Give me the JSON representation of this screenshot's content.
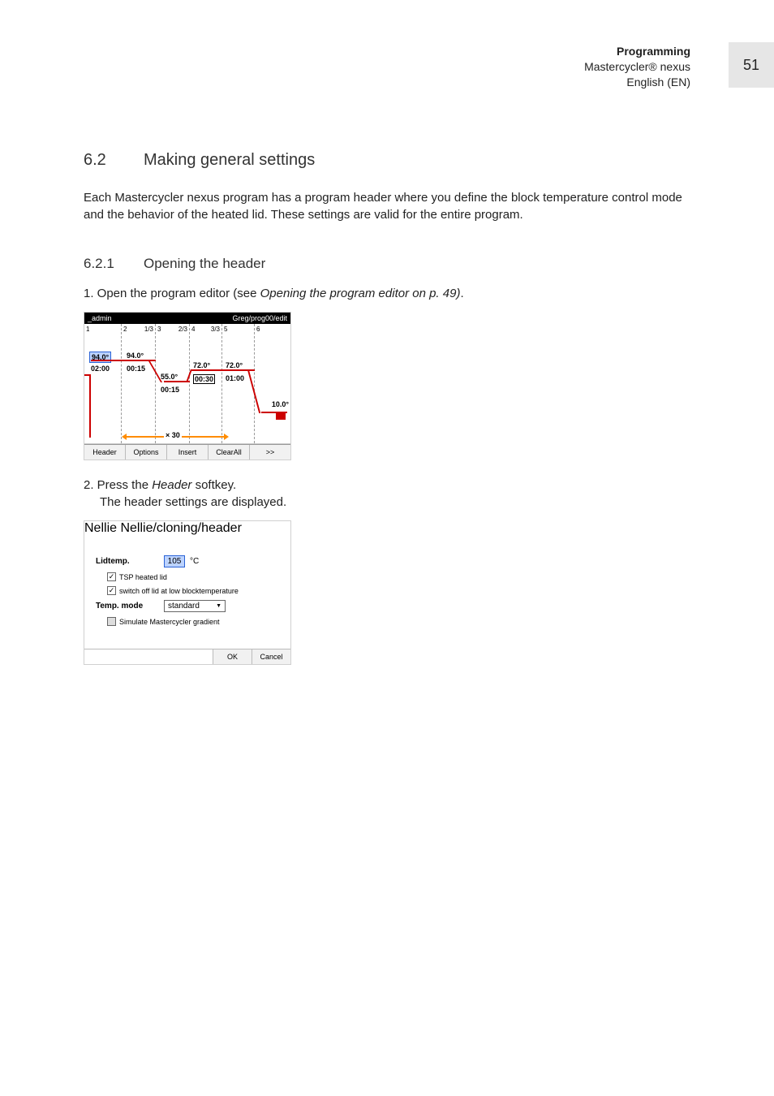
{
  "header": {
    "title": "Programming",
    "product": "Mastercycler® nexus",
    "lang": "English (EN)",
    "page_number": "51"
  },
  "section": {
    "num": "6.2",
    "title": "Making general settings",
    "intro": "Each Mastercycler nexus program has a program header where you define the block temperature control mode and the behavior of the heated lid. These settings are valid for the entire program."
  },
  "subsection": {
    "num": "6.2.1",
    "title": "Opening the header"
  },
  "steps": {
    "s1_prefix": "1.  Open the program editor (see ",
    "s1_em": "Opening the program editor on p. 49)",
    "s1_suffix": ".",
    "s2_prefix": "2.  Press the ",
    "s2_em": "Header",
    "s2_suffix": " softkey.",
    "s2_sub": "The header settings are displayed."
  },
  "shot1": {
    "bar_left": "_admin",
    "bar_right": "Greg/prog00/edit",
    "cols": {
      "c1": {
        "head": "1",
        "page": "",
        "temp_sel": "94.0°",
        "time": "02:00"
      },
      "c2": {
        "head": "2",
        "page": "1/3",
        "temp": "94.0°",
        "time": "00:15"
      },
      "c3": {
        "head": "3",
        "page": "2/3",
        "temp": "55.0°",
        "time": "00:15"
      },
      "c4": {
        "head": "4",
        "page": "3/3",
        "temp": "72.0°",
        "time": "00:30"
      },
      "c5": {
        "head": "5",
        "page": "",
        "temp": "72.0°",
        "time": "01:00"
      },
      "c6": {
        "head": "6",
        "page": "",
        "temp": "10.0°"
      }
    },
    "loop_label": "× 30",
    "softkeys": [
      "Header",
      "Options",
      "Insert",
      "ClearAll",
      ">>"
    ]
  },
  "shot2": {
    "bar_left": "Nellie",
    "bar_right": "Nellie/cloning/header",
    "lidtemp_label": "Lidtemp.",
    "lidtemp_value": "105",
    "lidtemp_unit": "°C",
    "chk_tsp": "TSP heated lid",
    "chk_switchoff": "switch off lid at low blocktemperature",
    "tempmode_label": "Temp. mode",
    "tempmode_value": "standard",
    "chk_simulate": "Simulate Mastercycler gradient",
    "ok": "OK",
    "cancel": "Cancel"
  }
}
